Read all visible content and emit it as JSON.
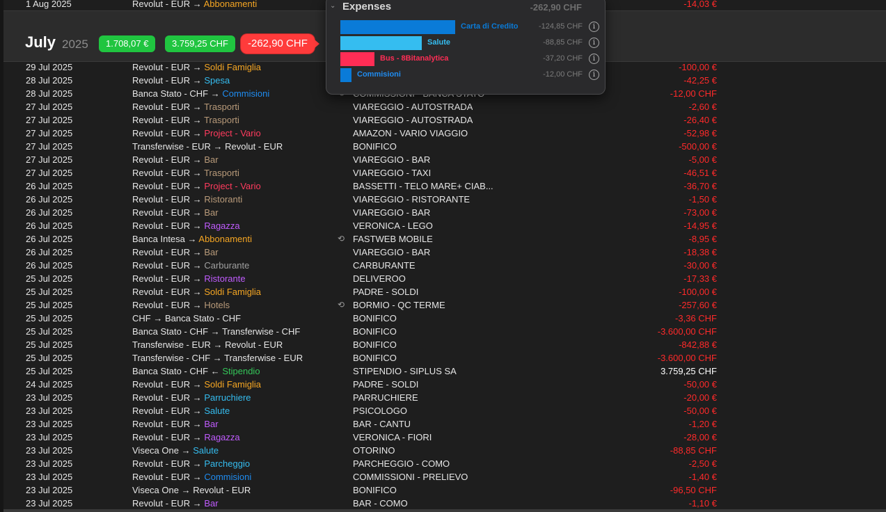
{
  "colors": {
    "negative": "#ff2a2a",
    "orange": "#f5a623",
    "blue": "#3a9dff",
    "brown": "#b99b7a",
    "pink": "#ff3b5e",
    "purple": "#c15cff",
    "gray": "#a0a0a0",
    "green": "#34c759"
  },
  "top_row": {
    "date": "1 Aug 2025",
    "account_prefix": "Revolut - EUR →",
    "category": "Abbonamenti",
    "category_color": "#f5a623",
    "amount": "-14,03 €"
  },
  "month": {
    "name": "July",
    "year": "2025",
    "pill_1": "1.708,07 €",
    "pill_2": "3.759,25 CHF",
    "pill_3": "-262,90 CHF"
  },
  "popover": {
    "title": "Expenses",
    "total": "-262,90 CHF",
    "items": [
      {
        "label": "Carta di Credito",
        "amount": "-124,85 CHF",
        "value": 124.85,
        "color": "#0a7bd8",
        "label_color": "#0a7bd8"
      },
      {
        "label": "Salute",
        "amount": "-88,85 CHF",
        "value": 88.85,
        "color": "#35bdf0",
        "label_color": "#35bdf0"
      },
      {
        "label": "Bus - 8Bitanalytica",
        "amount": "-37,20 CHF",
        "value": 37.2,
        "color": "#ff2d55",
        "label_color": "#ff2d55"
      },
      {
        "label": "Commisioni",
        "amount": "-12,00 CHF",
        "value": 12.0,
        "color": "#0a7bd8",
        "label_color": "#1f8cf0"
      }
    ]
  },
  "transactions": [
    {
      "date": "29 Jul 2025",
      "prefix": "Revolut - EUR →",
      "category": "Soldi Famiglia",
      "cat_color": "#f5a623",
      "sync": "",
      "desc": "",
      "amount": "-100,00 €",
      "positive": false
    },
    {
      "date": "28 Jul 2025",
      "prefix": "Revolut - EUR →",
      "category": "Spesa",
      "cat_color": "#35bdf0",
      "sync": "",
      "desc": "",
      "amount": "-42,25 €",
      "positive": false
    },
    {
      "date": "28 Jul 2025",
      "prefix": "Banca Stato - CHF →",
      "category": "Commisioni",
      "cat_color": "#1f8cf0",
      "sync": "⟲",
      "desc": "COMMISSIONI - BANCA STATO",
      "amount": "-12,00 CHF",
      "positive": false
    },
    {
      "date": "27 Jul 2025",
      "prefix": "Revolut - EUR →",
      "category": "Trasporti",
      "cat_color": "#b99b7a",
      "sync": "",
      "desc": "VIAREGGIO - AUTOSTRADA",
      "amount": "-2,60 €",
      "positive": false
    },
    {
      "date": "27 Jul 2025",
      "prefix": "Revolut - EUR →",
      "category": "Trasporti",
      "cat_color": "#b99b7a",
      "sync": "",
      "desc": "VIAREGGIO - AUTOSTRADA",
      "amount": "-26,40 €",
      "positive": false
    },
    {
      "date": "27 Jul 2025",
      "prefix": "Revolut - EUR →",
      "category": "Project - Vario",
      "cat_color": "#ff3b5e",
      "sync": "",
      "desc": "AMAZON - VARIO VIAGGIO",
      "amount": "-52,98 €",
      "positive": false
    },
    {
      "date": "27 Jul 2025",
      "prefix": "Transferwise - EUR → Revolut - EUR",
      "category": "",
      "cat_color": "#e6e6e6",
      "sync": "",
      "desc": "BONIFICO",
      "amount": "-500,00 €",
      "positive": false
    },
    {
      "date": "27 Jul 2025",
      "prefix": "Revolut - EUR →",
      "category": "Bar",
      "cat_color": "#b99b7a",
      "sync": "",
      "desc": "VIAREGGIO - BAR",
      "amount": "-5,00 €",
      "positive": false
    },
    {
      "date": "27 Jul 2025",
      "prefix": "Revolut - EUR →",
      "category": "Trasporti",
      "cat_color": "#b99b7a",
      "sync": "",
      "desc": "VIAREGGIO - TAXI",
      "amount": "-46,51 €",
      "positive": false
    },
    {
      "date": "26 Jul 2025",
      "prefix": "Revolut - EUR →",
      "category": "Project - Vario",
      "cat_color": "#ff3b5e",
      "sync": "",
      "desc": "BASSETTI - TELO MARE+ CIAB...",
      "amount": "-36,70 €",
      "positive": false
    },
    {
      "date": "26 Jul 2025",
      "prefix": "Revolut - EUR →",
      "category": "Ristoranti",
      "cat_color": "#b99b7a",
      "sync": "",
      "desc": "VIAREGGIO - RISTORANTE",
      "amount": "-1,50 €",
      "positive": false
    },
    {
      "date": "26 Jul 2025",
      "prefix": "Revolut - EUR →",
      "category": "Bar",
      "cat_color": "#b99b7a",
      "sync": "",
      "desc": "VIAREGGIO - BAR",
      "amount": "-73,00 €",
      "positive": false
    },
    {
      "date": "26 Jul 2025",
      "prefix": "Revolut - EUR →",
      "category": "Ragazza",
      "cat_color": "#c15cff",
      "sync": "",
      "desc": "VERONICA - LEGO",
      "amount": "-14,95 €",
      "positive": false
    },
    {
      "date": "26 Jul 2025",
      "prefix": "Banca Intesa →",
      "category": "Abbonamenti",
      "cat_color": "#f5a623",
      "sync": "⟲",
      "desc": "FASTWEB MOBILE",
      "amount": "-8,95 €",
      "positive": false
    },
    {
      "date": "26 Jul 2025",
      "prefix": "Revolut - EUR →",
      "category": "Bar",
      "cat_color": "#b99b7a",
      "sync": "",
      "desc": "VIAREGGIO - BAR",
      "amount": "-18,38 €",
      "positive": false
    },
    {
      "date": "26 Jul 2025",
      "prefix": "Revolut - EUR →",
      "category": "Carburante",
      "cat_color": "#a0a0a0",
      "sync": "",
      "desc": "CARBURANTE",
      "amount": "-30,00 €",
      "positive": false
    },
    {
      "date": "25 Jul 2025",
      "prefix": "Revolut - EUR →",
      "category": "Ristorante",
      "cat_color": "#c15cff",
      "sync": "",
      "desc": "DELIVEROO",
      "amount": "-17,33 €",
      "positive": false
    },
    {
      "date": "25 Jul 2025",
      "prefix": "Revolut - EUR →",
      "category": "Soldi Famiglia",
      "cat_color": "#f5a623",
      "sync": "",
      "desc": "PADRE - SOLDI",
      "amount": "-100,00 €",
      "positive": false
    },
    {
      "date": "25 Jul 2025",
      "prefix": "Revolut - EUR →",
      "category": "Hotels",
      "cat_color": "#b99b7a",
      "sync": "⟲",
      "desc": "BORMIO - QC TERME",
      "amount": "-257,60 €",
      "positive": false
    },
    {
      "date": "25 Jul 2025",
      "prefix": "CHF → Banca Stato - CHF",
      "category": "",
      "cat_color": "#e6e6e6",
      "sync": "",
      "desc": "BONIFICO",
      "amount": "-3,36 CHF",
      "positive": false
    },
    {
      "date": "25 Jul 2025",
      "prefix": "Banca Stato - CHF → Transferwise - CHF",
      "category": "",
      "cat_color": "#e6e6e6",
      "sync": "",
      "desc": "BONIFICO",
      "amount": "-3.600,00 CHF",
      "positive": false
    },
    {
      "date": "25 Jul 2025",
      "prefix": "Transferwise - EUR → Revolut - EUR",
      "category": "",
      "cat_color": "#e6e6e6",
      "sync": "",
      "desc": "BONIFICO",
      "amount": "-842,88 €",
      "positive": false
    },
    {
      "date": "25 Jul 2025",
      "prefix": "Transferwise - CHF → Transferwise - EUR",
      "category": "",
      "cat_color": "#e6e6e6",
      "sync": "",
      "desc": "BONIFICO",
      "amount": "-3.600,00 CHF",
      "positive": false
    },
    {
      "date": "25 Jul 2025",
      "prefix": "Banca Stato - CHF ←",
      "category": "Stipendio",
      "cat_color": "#34c759",
      "sync": "",
      "desc": "STIPENDIO - SIPLUS SA",
      "amount": "3.759,25 CHF",
      "positive": true
    },
    {
      "date": "24 Jul 2025",
      "prefix": "Revolut - EUR →",
      "category": "Soldi Famiglia",
      "cat_color": "#f5a623",
      "sync": "",
      "desc": "PADRE - SOLDI",
      "amount": "-50,00 €",
      "positive": false
    },
    {
      "date": "23 Jul 2025",
      "prefix": "Revolut - EUR →",
      "category": "Parruchiere",
      "cat_color": "#35bdf0",
      "sync": "",
      "desc": "PARRUCHIERE",
      "amount": "-20,00 €",
      "positive": false
    },
    {
      "date": "23 Jul 2025",
      "prefix": "Revolut - EUR →",
      "category": "Salute",
      "cat_color": "#35bdf0",
      "sync": "",
      "desc": "PSICOLOGO",
      "amount": "-50,00 €",
      "positive": false
    },
    {
      "date": "23 Jul 2025",
      "prefix": "Revolut - EUR →",
      "category": "Bar",
      "cat_color": "#c15cff",
      "sync": "",
      "desc": "BAR - CANTU",
      "amount": "-1,20 €",
      "positive": false
    },
    {
      "date": "23 Jul 2025",
      "prefix": "Revolut - EUR →",
      "category": "Ragazza",
      "cat_color": "#c15cff",
      "sync": "",
      "desc": "VERONICA - FIORI",
      "amount": "-28,00 €",
      "positive": false
    },
    {
      "date": "23 Jul 2025",
      "prefix": "Viseca One →",
      "category": "Salute",
      "cat_color": "#35bdf0",
      "sync": "",
      "desc": "OTORINO",
      "amount": "-88,85 CHF",
      "positive": false
    },
    {
      "date": "23 Jul 2025",
      "prefix": "Revolut - EUR →",
      "category": "Parcheggio",
      "cat_color": "#35bdf0",
      "sync": "",
      "desc": "PARCHEGGIO - COMO",
      "amount": "-2,50 €",
      "positive": false
    },
    {
      "date": "23 Jul 2025",
      "prefix": "Revolut - EUR →",
      "category": "Commisioni",
      "cat_color": "#1f8cf0",
      "sync": "",
      "desc": "COMMISSIONI - PRELIEVO",
      "amount": "-1,40 €",
      "positive": false
    },
    {
      "date": "23 Jul 2025",
      "prefix": "Viseca One → Revolut - EUR",
      "category": "",
      "cat_color": "#e6e6e6",
      "sync": "",
      "desc": "BONIFICO",
      "amount": "-96,50 CHF",
      "positive": false
    },
    {
      "date": "23 Jul 2025",
      "prefix": "Revolut - EUR →",
      "category": "Bar",
      "cat_color": "#c15cff",
      "sync": "",
      "desc": "BAR - COMO",
      "amount": "-1,10 €",
      "positive": false
    }
  ]
}
